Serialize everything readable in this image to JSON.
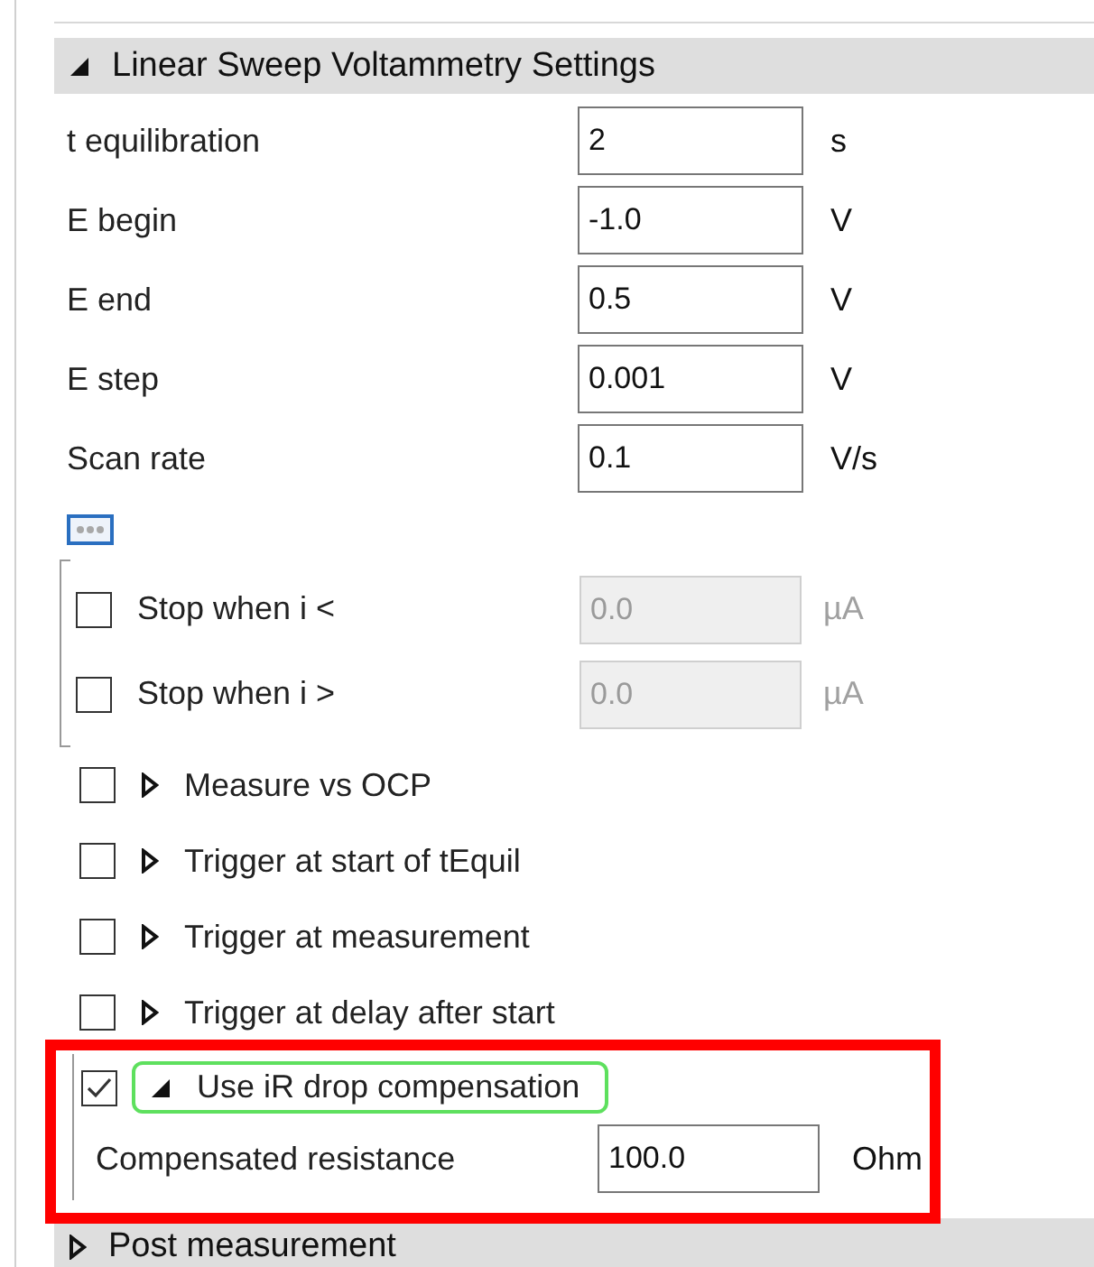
{
  "section": {
    "title": "Linear Sweep Voltammetry Settings",
    "expanded": true
  },
  "parameters": [
    {
      "label": "t equilibration",
      "value": "2",
      "unit": "s"
    },
    {
      "label": "E begin",
      "value": "-1.0",
      "unit": "V"
    },
    {
      "label": "E end",
      "value": "0.5",
      "unit": "V"
    },
    {
      "label": "E step",
      "value": "0.001",
      "unit": "V"
    },
    {
      "label": "Scan rate",
      "value": "0.1",
      "unit": "V/s"
    }
  ],
  "stop_conditions": [
    {
      "label": "Stop when i <",
      "checked": false,
      "value": "0.0",
      "unit": "µA",
      "disabled": true
    },
    {
      "label": "Stop when i >",
      "checked": false,
      "value": "0.0",
      "unit": "µA",
      "disabled": true
    }
  ],
  "options": [
    {
      "label": "Measure vs OCP",
      "checked": false,
      "expanded": false
    },
    {
      "label": "Trigger at start of tEquil",
      "checked": false,
      "expanded": false
    },
    {
      "label": "Trigger at measurement",
      "checked": false,
      "expanded": false
    },
    {
      "label": "Trigger at delay after start",
      "checked": false,
      "expanded": false
    }
  ],
  "ir_compensation": {
    "label": "Use iR drop compensation",
    "checked": true,
    "expanded": true,
    "focused": true,
    "highlighted": true,
    "field_label": "Compensated resistance",
    "value": "100.0",
    "unit": "Ohm"
  },
  "next_section": {
    "title": "Post measurement",
    "expanded": false
  }
}
